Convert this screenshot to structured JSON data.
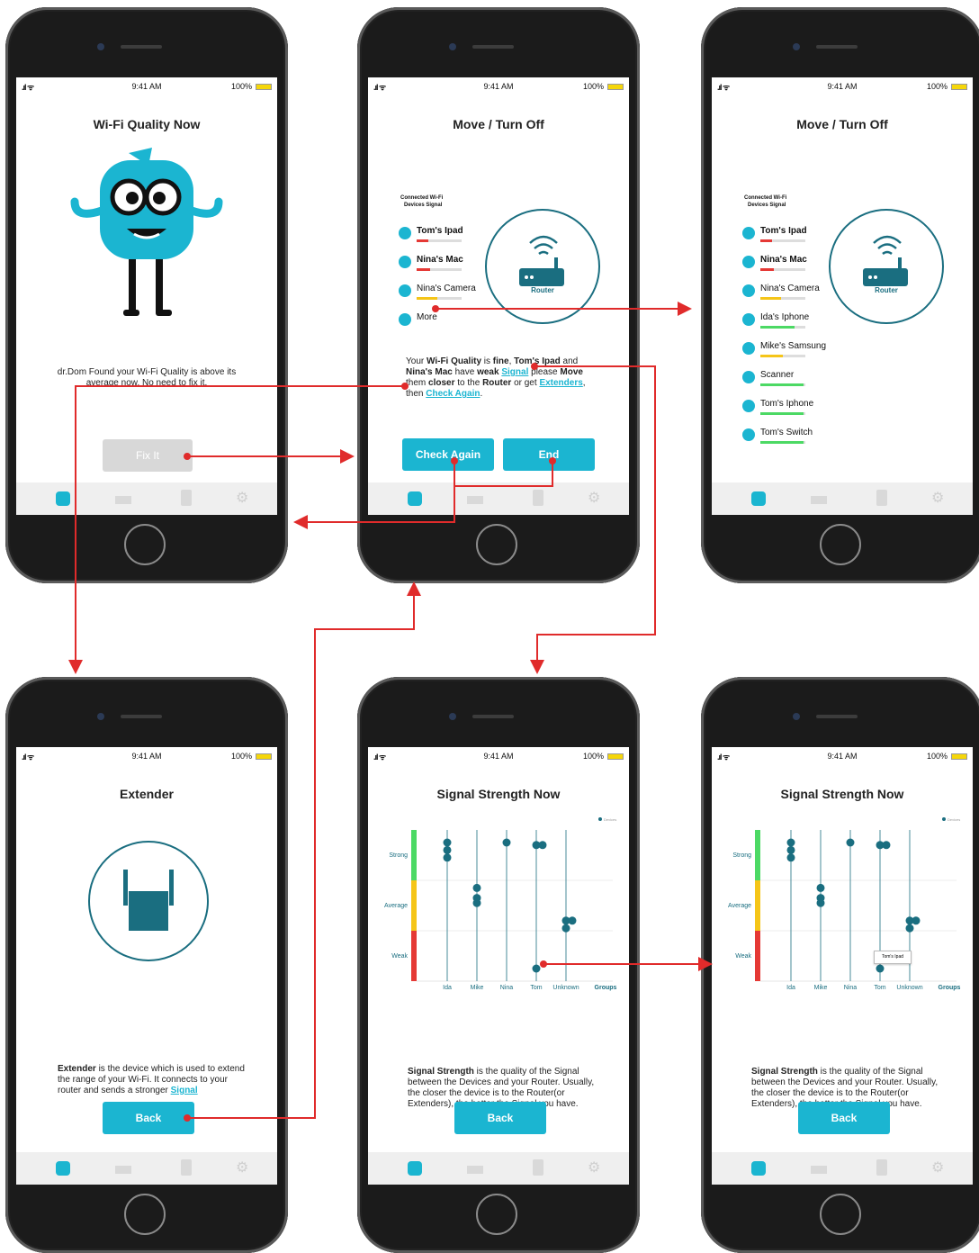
{
  "status": {
    "time": "9:41 AM",
    "battery": "100%"
  },
  "screen1": {
    "title": "Wi-Fi Quality Now",
    "message": "dr.Dom Found your Wi-Fi Quality is above its average now. No need to fix it.",
    "fix_button": "Fix It"
  },
  "screen2": {
    "title": "Move / Turn Off",
    "connected_label_1": "Connected Wi-Fi",
    "connected_label_2": "Devices Signal",
    "devices": [
      {
        "name": "Tom's Ipad",
        "bold": true,
        "level": 0.25,
        "color": "#e53935"
      },
      {
        "name": "Nina's Mac",
        "bold": true,
        "level": 0.3,
        "color": "#e53935"
      },
      {
        "name": "Nina's Camera",
        "bold": false,
        "level": 0.45,
        "color": "#f5c518"
      }
    ],
    "more_label": "More",
    "router_label": "Router",
    "para_1": "Your ",
    "para_wq": "Wi-Fi Quality",
    "para_2": " is ",
    "para_fine": "fine",
    "para_3": ", ",
    "para_tom": "Tom's Ipad",
    "para_4": " and ",
    "para_nina": "Nina's Mac",
    "para_5": " have ",
    "para_weak": "weak",
    "para_6": " ",
    "para_signal": "Signal",
    "para_7": " please ",
    "para_move": "Move",
    "para_8": " them ",
    "para_closer": "closer",
    "para_9": " to the ",
    "para_router": "Router",
    "para_10": " or get ",
    "para_ext": "Extenders",
    "para_11": ", then ",
    "para_check": "Check Again",
    "para_12": ".",
    "check_button": "Check Again",
    "end_button": "End"
  },
  "screen3": {
    "title": "Move / Turn Off",
    "connected_label_1": "Connected Wi-Fi",
    "connected_label_2": "Devices Signal",
    "router_label": "Router",
    "devices": [
      {
        "name": "Tom's Ipad",
        "bold": true,
        "level": 0.25,
        "color": "#e53935"
      },
      {
        "name": "Nina's Mac",
        "bold": true,
        "level": 0.3,
        "color": "#e53935"
      },
      {
        "name": "Nina's Camera",
        "bold": false,
        "level": 0.45,
        "color": "#f5c518"
      },
      {
        "name": "Ida's Iphone",
        "bold": false,
        "level": 0.75,
        "color": "#4cd964"
      },
      {
        "name": "Mike's Samsung",
        "bold": false,
        "level": 0.5,
        "color": "#f5c518"
      },
      {
        "name": "Scanner",
        "bold": false,
        "level": 0.95,
        "color": "#4cd964"
      },
      {
        "name": "Tom's Iphone",
        "bold": false,
        "level": 0.95,
        "color": "#4cd964"
      },
      {
        "name": "Tom's Switch",
        "bold": false,
        "level": 0.95,
        "color": "#4cd964"
      }
    ]
  },
  "screen4": {
    "title": "Extender",
    "para_bold": "Extender",
    "para_text": " is the device which is used to extend the range of your Wi-Fi. It connects to your router and sends a stronger ",
    "para_link": "Signal",
    "back_button": "Back"
  },
  "screen5": {
    "title": "Signal Strength Now",
    "legend": "Devices",
    "groups_label": "Groups",
    "para_bold": "Signal Strength",
    "para_text": " is the quality of the Signal between the Devices and your Router. Usually, the closer the device is to the Router(or Extenders), the better the Signal you have.",
    "back_button": "Back"
  },
  "screen6": {
    "title": "Signal Strength Now",
    "legend": "Devices",
    "groups_label": "Groups",
    "tooltip": "Tom's Ipad",
    "para_bold": "Signal Strength",
    "para_text": " is the quality of the Signal between the Devices and your Router. Usually, the closer the device is to the Router(or Extenders), the better the Signal you have.",
    "back_button": "Back"
  },
  "chart_data": {
    "type": "scatter",
    "categories": [
      "Ida",
      "Mike",
      "Nina",
      "Tom",
      "Unknown"
    ],
    "y_levels": [
      "Weak",
      "Average",
      "Strong"
    ],
    "ylim": [
      0,
      3
    ],
    "series": [
      {
        "name": "Devices",
        "points": [
          {
            "x": "Ida",
            "y": 2.75
          },
          {
            "x": "Ida",
            "y": 2.6
          },
          {
            "x": "Ida",
            "y": 2.45
          },
          {
            "x": "Mike",
            "y": 1.85
          },
          {
            "x": "Mike",
            "y": 1.65
          },
          {
            "x": "Mike",
            "y": 1.55
          },
          {
            "x": "Nina",
            "y": 2.75
          },
          {
            "x": "Tom",
            "y": 2.7
          },
          {
            "x": "Tom",
            "y": 2.7
          },
          {
            "x": "Tom",
            "y": 0.25
          },
          {
            "x": "Unknown",
            "y": 1.2
          },
          {
            "x": "Unknown",
            "y": 1.2
          },
          {
            "x": "Unknown",
            "y": 1.05
          }
        ]
      }
    ],
    "color": "#1a6e80"
  },
  "colors": {
    "accent": "#1bb5d1",
    "dark_teal": "#1a6e80",
    "arrow": "#e02b2b",
    "weak": "#e53935",
    "avg": "#f5c518",
    "strong": "#4cd964"
  }
}
